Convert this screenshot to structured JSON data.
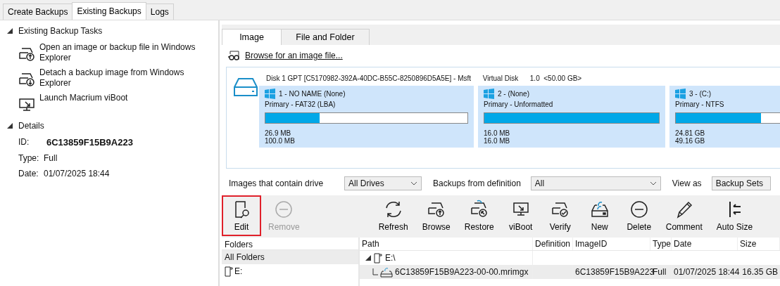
{
  "tabs": [
    {
      "label": "Create Backups",
      "selected": false
    },
    {
      "label": "Existing Backups",
      "selected": true
    },
    {
      "label": "Logs",
      "selected": false
    }
  ],
  "sidebar": {
    "sections": [
      {
        "title": "Existing Backup Tasks",
        "expanded": true,
        "tasks": [
          {
            "label": "Open an image or backup file in Windows Explorer"
          },
          {
            "label": "Detach a backup image from Windows Explorer"
          },
          {
            "label": "Launch Macrium viBoot"
          }
        ]
      },
      {
        "title": "Details",
        "expanded": true,
        "details": [
          {
            "label": "ID:",
            "value": "6C13859F15B9A223"
          },
          {
            "label": "Type:",
            "value": "Full"
          },
          {
            "label": "Date:",
            "value": "01/07/2025 18:44"
          }
        ]
      }
    ]
  },
  "subtabs": [
    {
      "label": "Image",
      "selected": true
    },
    {
      "label": "File and Folder",
      "selected": false
    }
  ],
  "browse_link": "Browse for an image file...",
  "disk": {
    "title": "Disk 1 GPT [C5170982-392A-40DC-B55C-8250896D5A5E] - Msft      Virtual Disk      1.0  <50.00 GB>",
    "partitions": [
      {
        "name": "1 - NO NAME (None)",
        "type": "Primary - FAT32 (LBA)",
        "level": 0.27,
        "used": "26.9 MB",
        "total": "100.0 MB"
      },
      {
        "name": "2 -  (None)",
        "type": "Primary - Unformatted",
        "level": 1,
        "used": "16.0 MB",
        "total": "16.0 MB"
      },
      {
        "name": "3 -  (C:)",
        "type": "Primary - NTFS",
        "level": 0.5,
        "used": "24.81 GB",
        "total": "49.16 GB"
      }
    ]
  },
  "filters": [
    {
      "label": "Images that contain drive",
      "value": "All Drives"
    },
    {
      "label": "Backups from definition",
      "value": "All"
    },
    {
      "label": "View as",
      "value": "Backup Sets"
    }
  ],
  "toolbar": [
    {
      "label": "Edit",
      "disabled": false,
      "highlighted": true
    },
    {
      "label": "Remove",
      "disabled": true,
      "highlighted": false
    },
    {
      "label": "Refresh",
      "disabled": false,
      "highlighted": false
    },
    {
      "label": "Browse",
      "disabled": false,
      "highlighted": false
    },
    {
      "label": "Restore",
      "disabled": false,
      "highlighted": false
    },
    {
      "label": "viBoot",
      "disabled": false,
      "highlighted": false
    },
    {
      "label": "Verify",
      "disabled": false,
      "highlighted": false
    },
    {
      "label": "New",
      "disabled": false,
      "highlighted": false
    },
    {
      "label": "Delete",
      "disabled": false,
      "highlighted": false
    },
    {
      "label": "Comment",
      "disabled": false,
      "highlighted": false
    },
    {
      "label": "Auto Size",
      "disabled": false,
      "highlighted": false
    }
  ],
  "folders": {
    "header": "Folders",
    "items": [
      {
        "label": "All Folders",
        "selected": true,
        "kind": "all"
      },
      {
        "label": "E:",
        "selected": false,
        "kind": "drive"
      }
    ]
  },
  "table": {
    "columns": [
      "Path",
      "Definition",
      "ImageID",
      "Type",
      "Date",
      "Size"
    ],
    "rows": [
      {
        "path": "E:\\",
        "expanded": true,
        "children": [
          {
            "path": "6C13859F15B9A223-00-00.mrimgx",
            "image_id": "6C13859F15B9A223",
            "type": "Full",
            "date": "01/07/2025 18:44",
            "size": "16.35 GB"
          }
        ]
      }
    ]
  }
}
